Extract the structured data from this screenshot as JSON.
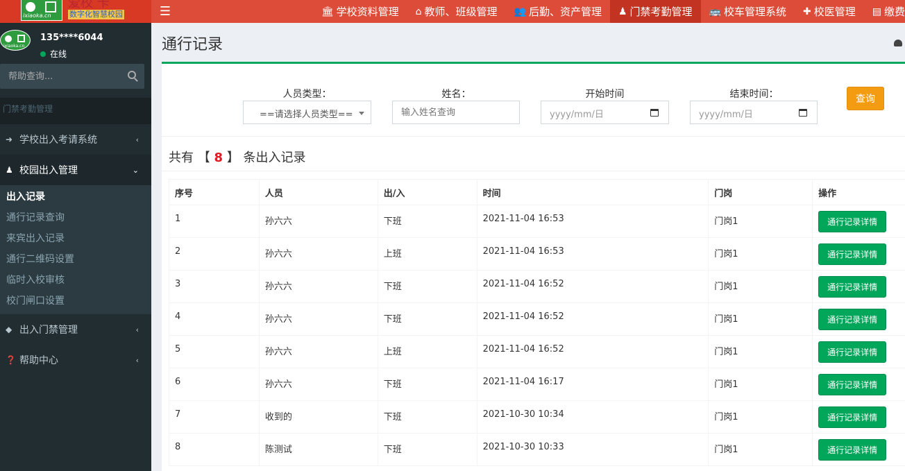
{
  "logo": {
    "title": "爱校 卡",
    "subtitle": "数字化智慧校园",
    "domain": "ixiaoka.cn"
  },
  "topnav": [
    {
      "label": "学校资料管理",
      "icon": "bank-icon"
    },
    {
      "label": "教师、班级管理",
      "icon": "home-icon"
    },
    {
      "label": "后勤、资产管理",
      "icon": "users-icon"
    },
    {
      "label": "门禁考勤管理",
      "icon": "user-icon",
      "active": true
    },
    {
      "label": "校车管理系统",
      "icon": "bus-icon"
    },
    {
      "label": "校医管理",
      "icon": "plus-icon"
    },
    {
      "label": "缴费",
      "icon": "id-card-icon"
    }
  ],
  "user": {
    "name": "135****6044",
    "status": "在线"
  },
  "search": {
    "placeholder": "帮助查询..."
  },
  "sidebar": {
    "header": "门禁考勤管理",
    "menu": [
      {
        "label": "学校出入考请系统",
        "icon": "sign-in-icon",
        "chevron": "‹"
      },
      {
        "label": "校园出入管理",
        "icon": "person-icon",
        "chevron": "⌄"
      },
      {
        "label": "出入门禁管理",
        "icon": "cube-icon",
        "chevron": "‹"
      },
      {
        "label": "帮助中心",
        "icon": "question-icon",
        "chevron": "‹"
      }
    ],
    "submenu": [
      "出入记录",
      "通行记录查询",
      "来宾出入记录",
      "通行二维码设置",
      "临时入校审核",
      "校门闸口设置"
    ]
  },
  "page": {
    "title": "通行记录"
  },
  "filter": {
    "person_type_label": "人员类型：",
    "person_type_value": "==请选择人员类型==",
    "name_label": "姓名：",
    "name_placeholder": "输入姓名查询",
    "start_label": "开始时间",
    "start_placeholder": "yyyy/mm/日",
    "end_label": "结束时间：",
    "end_placeholder": "yyyy/mm/日",
    "query_label": "查询"
  },
  "summary": {
    "prefix": "共有 【",
    "count": "8",
    "suffix": "】 条出入记录"
  },
  "table": {
    "columns": [
      "序号",
      "人员",
      "出/入",
      "时间",
      "门岗",
      "操作"
    ],
    "button_label": "通行记录详情",
    "rows": [
      {
        "no": "1",
        "person": "孙六六",
        "direction": "下班",
        "time": "2021-11-04 16:53",
        "gate": "门岗1"
      },
      {
        "no": "2",
        "person": "孙六六",
        "direction": "上班",
        "time": "2021-11-04 16:53",
        "gate": "门岗1"
      },
      {
        "no": "3",
        "person": "孙六六",
        "direction": "下班",
        "time": "2021-11-04 16:52",
        "gate": "门岗1"
      },
      {
        "no": "4",
        "person": "孙六六",
        "direction": "下班",
        "time": "2021-11-04 16:52",
        "gate": "门岗1"
      },
      {
        "no": "5",
        "person": "孙六六",
        "direction": "上班",
        "time": "2021-11-04 16:52",
        "gate": "门岗1"
      },
      {
        "no": "6",
        "person": "孙六六",
        "direction": "下班",
        "time": "2021-11-04 16:17",
        "gate": "门岗1"
      },
      {
        "no": "7",
        "person": "收到的",
        "direction": "下班",
        "time": "2021-10-30 10:34",
        "gate": "门岗1"
      },
      {
        "no": "8",
        "person": "陈测试",
        "direction": "下班",
        "time": "2021-10-30 10:33",
        "gate": "门岗1"
      }
    ]
  }
}
